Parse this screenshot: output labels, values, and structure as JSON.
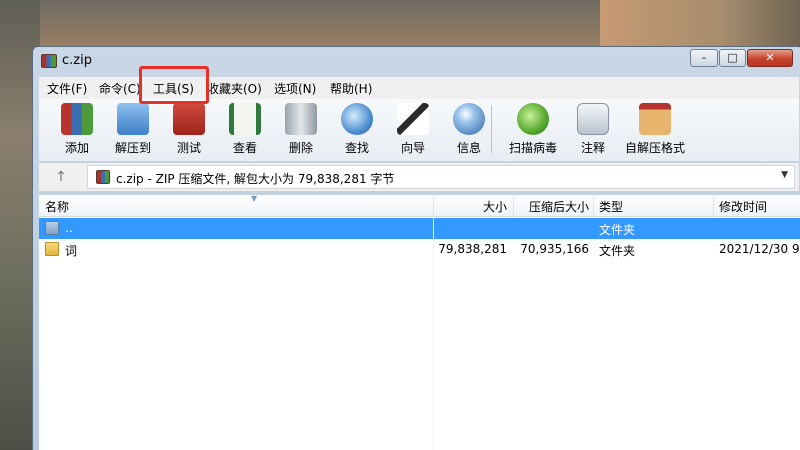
{
  "window": {
    "title": "c.zip",
    "minimize_glyph": "–",
    "maximize_glyph": "□",
    "close_glyph": "✕"
  },
  "menu": [
    "文件(F)",
    "命令(C)",
    "工具(S)",
    "收藏夹(O)",
    "选项(N)",
    "帮助(H)"
  ],
  "highlighted_menu": "工具(S)",
  "highlight_color": "#e8302a",
  "toolbar": [
    {
      "label": "添加",
      "icon": "add-archive-icon"
    },
    {
      "label": "解压到",
      "icon": "extract-to-icon"
    },
    {
      "label": "测试",
      "icon": "test-icon"
    },
    {
      "label": "查看",
      "icon": "view-book-icon"
    },
    {
      "label": "删除",
      "icon": "trash-icon"
    },
    {
      "label": "查找",
      "icon": "find-magnifier-icon"
    },
    {
      "label": "向导",
      "icon": "wizard-wand-icon"
    },
    {
      "label": "信息",
      "icon": "info-icon"
    },
    {
      "label": "扫描病毒",
      "icon": "virus-scan-icon"
    },
    {
      "label": "注释",
      "icon": "comment-icon"
    },
    {
      "label": "自解压格式",
      "icon": "sfx-box-icon"
    }
  ],
  "address": {
    "up_glyph": "↑",
    "text": "c.zip - ZIP 压缩文件, 解包大小为 79,838,281 字节",
    "dropdown_glyph": "▼"
  },
  "columns": [
    "名称",
    "大小",
    "压缩后大小",
    "类型",
    "修改时间"
  ],
  "rows": [
    {
      "name": "..",
      "size": "",
      "packed": "",
      "type": "文件夹",
      "modified": "",
      "selected": true
    },
    {
      "name": "词",
      "size": "79,838,281",
      "packed": "70,935,166",
      "type": "文件夹",
      "modified": "2021/12/30 9...",
      "selected": false
    }
  ],
  "colors": {
    "selection": "#3399ff",
    "close_button": "#c7432b"
  }
}
